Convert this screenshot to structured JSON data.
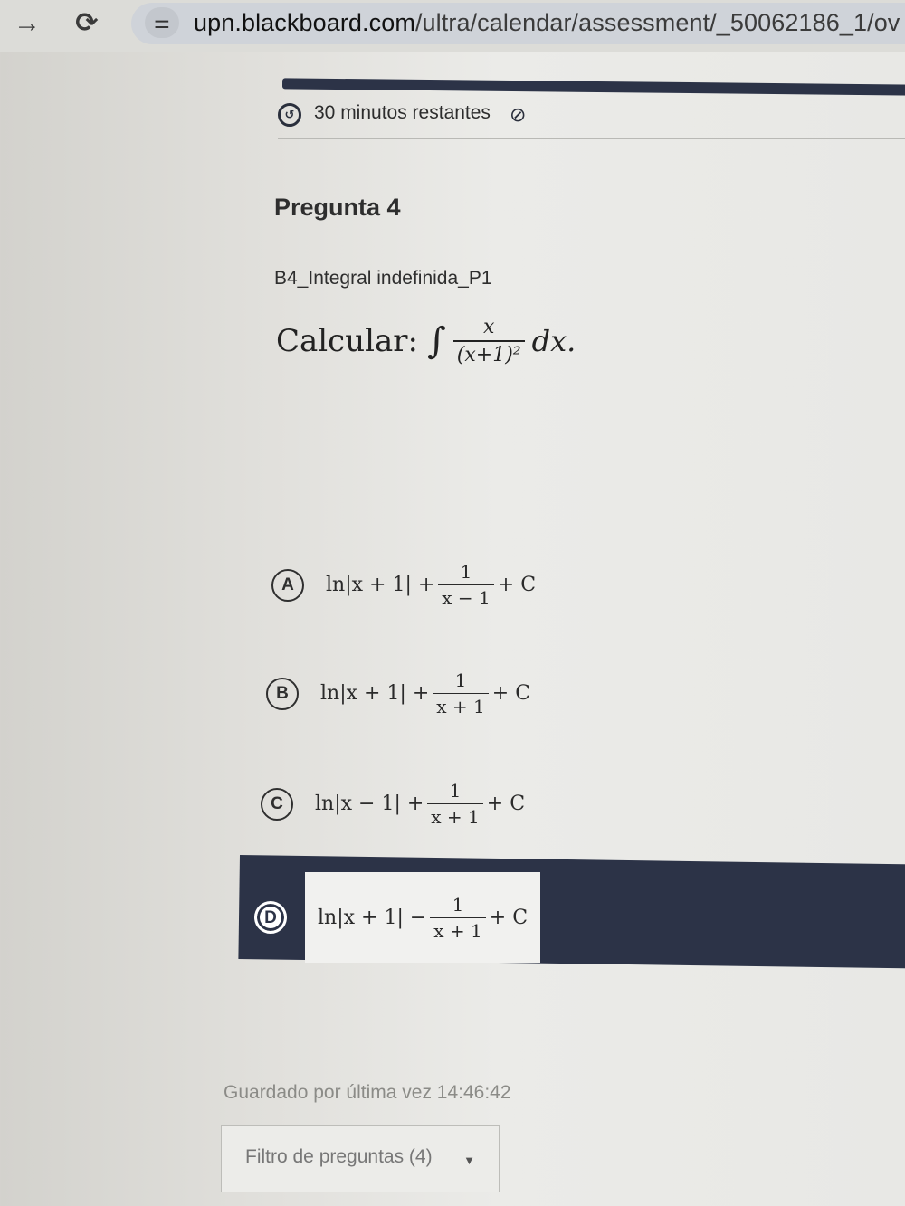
{
  "browser": {
    "forward_icon": "arrow-right-icon",
    "reload_icon": "reload-icon",
    "site_info_icon": "tune-icon",
    "url_host": "upn.blackboard.com",
    "url_path": "/ultra/calendar/assessment/_50062186_1/ov"
  },
  "assessment": {
    "progress": 1.0,
    "timer_text": "30 minutos restantes",
    "question_title": "Pregunta 4",
    "question_subtitle": "B4_Integral indefinida_P1",
    "stem": {
      "label": "Calcular:",
      "integral_sign": "∫",
      "numerator": "x",
      "denominator": "(x+1)²",
      "differential": "dx."
    },
    "options": [
      {
        "letter": "A",
        "ln_part": "ln|x + 1| +",
        "num": "1",
        "den": "x − 1",
        "tail": "+ C",
        "selected": false
      },
      {
        "letter": "B",
        "ln_part": "ln|x + 1| +",
        "num": "1",
        "den": "x + 1",
        "tail": "+ C",
        "selected": false
      },
      {
        "letter": "C",
        "ln_part": "ln|x − 1| +",
        "num": "1",
        "den": "x + 1",
        "tail": "+ C",
        "selected": false
      },
      {
        "letter": "D",
        "ln_part": "ln|x + 1| −",
        "num": "1",
        "den": "x + 1",
        "tail": "+ C",
        "selected": true
      }
    ],
    "saved_text": "Guardado por última vez 14:46:42",
    "filter_label": "Filtro de preguntas (4)"
  },
  "colors": {
    "accent": "#2c3347",
    "selected_option_bg": "#2c3347",
    "muted_text": "#8b8b87"
  }
}
